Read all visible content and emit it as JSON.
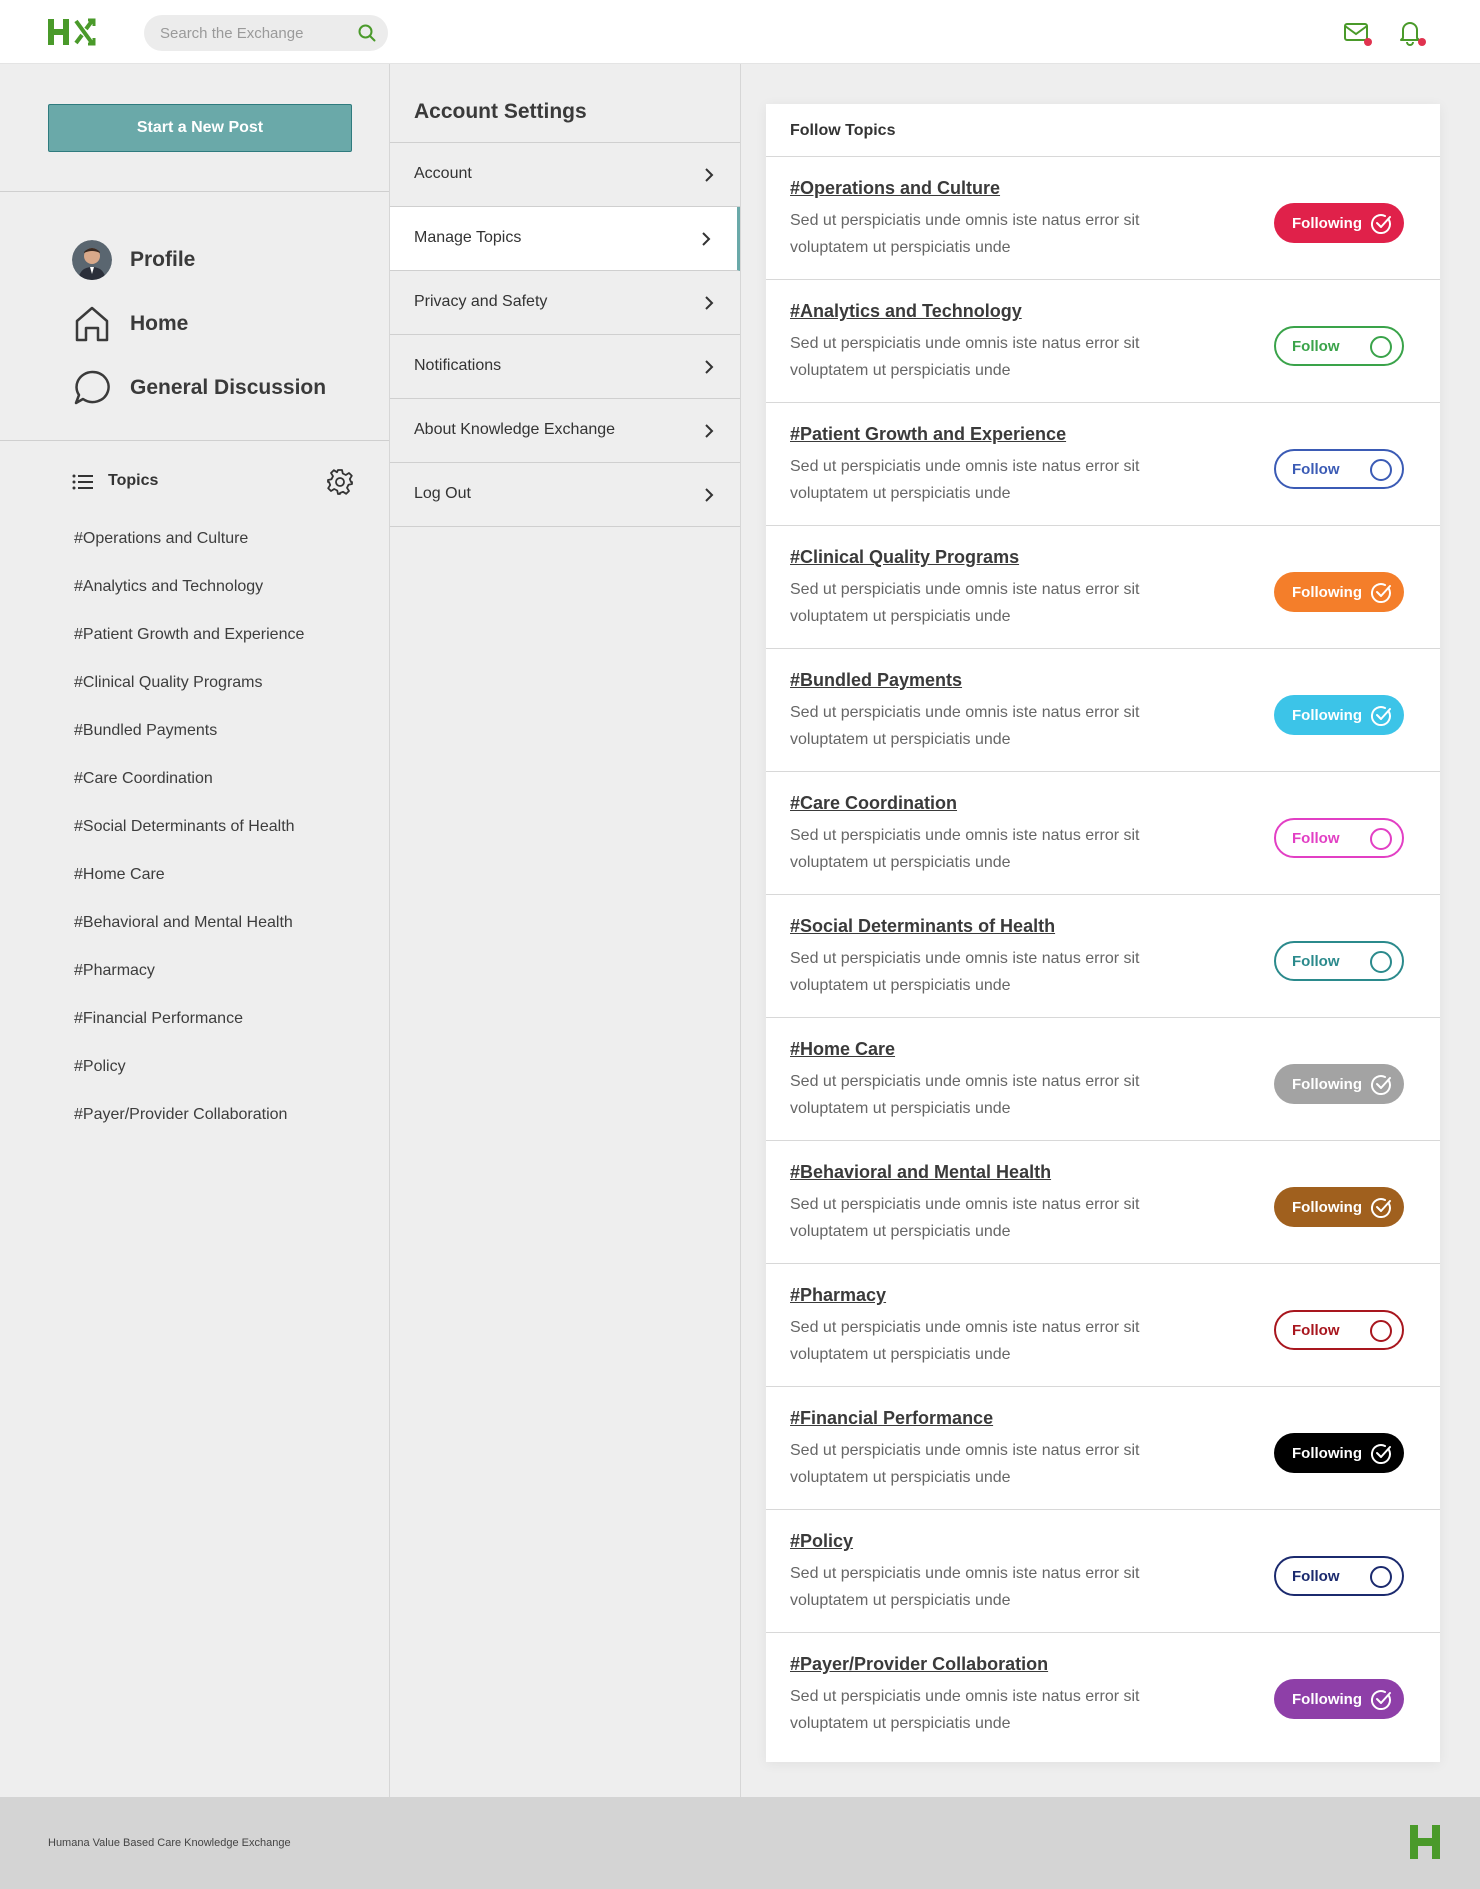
{
  "header": {
    "logo": "HX",
    "search_placeholder": "Search the Exchange",
    "icons": [
      "mail-icon",
      "bell-icon"
    ]
  },
  "sidebar": {
    "new_post_label": "Start a New Post",
    "nav": [
      {
        "label": "Profile",
        "icon": "avatar"
      },
      {
        "label": "Home",
        "icon": "home-icon"
      },
      {
        "label": "General Discussion",
        "icon": "chat-icon"
      }
    ],
    "topics_label": "Topics",
    "topics": [
      "#Operations and Culture",
      "#Analytics and Technology",
      "#Patient Growth and Experience",
      "#Clinical Quality Programs",
      "#Bundled Payments",
      "#Care Coordination",
      "#Social Determinants of Health",
      "#Home Care",
      "#Behavioral and Mental Health",
      "#Pharmacy",
      "#Financial Performance",
      "#Policy",
      "#Payer/Provider Collaboration"
    ]
  },
  "settings": {
    "title": "Account Settings",
    "menu": [
      {
        "label": "Account",
        "active": false
      },
      {
        "label": "Manage Topics",
        "active": true
      },
      {
        "label": "Privacy and Safety",
        "active": false
      },
      {
        "label": "Notifications",
        "active": false
      },
      {
        "label": "About Knowledge Exchange",
        "active": false
      },
      {
        "label": "Log Out",
        "active": false
      }
    ]
  },
  "follow_topics": {
    "title": "Follow Topics",
    "items": [
      {
        "title": "#Operations and Culture",
        "desc": "Sed ut perspiciatis unde omnis iste natus error sit voluptatem ut perspiciatis unde",
        "state": "Following",
        "color": "#e0214a"
      },
      {
        "title": "#Analytics and Technology",
        "desc": "Sed ut perspiciatis unde omnis iste natus error sit voluptatem ut perspiciatis unde",
        "state": "Follow",
        "color": "#3aa34a"
      },
      {
        "title": "#Patient Growth and Experience",
        "desc": "Sed ut perspiciatis unde omnis iste natus error sit voluptatem ut perspiciatis unde",
        "state": "Follow",
        "color": "#3b5bb5"
      },
      {
        "title": "#Clinical Quality Programs",
        "desc": "Sed ut perspiciatis unde omnis iste natus error sit voluptatem ut perspiciatis unde",
        "state": "Following",
        "color": "#f47e2a"
      },
      {
        "title": "#Bundled Payments",
        "desc": "Sed ut perspiciatis unde omnis iste natus error sit voluptatem ut perspiciatis unde",
        "state": "Following",
        "color": "#3cc4e8"
      },
      {
        "title": "#Care Coordination",
        "desc": "Sed ut perspiciatis unde omnis iste natus error sit voluptatem ut perspiciatis unde",
        "state": "Follow",
        "color": "#e23fc4"
      },
      {
        "title": "#Social Determinants of Health",
        "desc": "Sed ut perspiciatis unde omnis iste natus error sit voluptatem ut perspiciatis unde",
        "state": "Follow",
        "color": "#2b8a8c"
      },
      {
        "title": "#Home Care",
        "desc": "Sed ut perspiciatis unde omnis iste natus error sit voluptatem ut perspiciatis unde",
        "state": "Following",
        "color": "#a3a3a3"
      },
      {
        "title": "#Behavioral and Mental Health",
        "desc": "Sed ut perspiciatis unde omnis iste natus error sit voluptatem ut perspiciatis unde",
        "state": "Following",
        "color": "#a0601e"
      },
      {
        "title": "#Pharmacy",
        "desc": "Sed ut perspiciatis unde omnis iste natus error sit voluptatem ut perspiciatis unde",
        "state": "Follow",
        "color": "#a8161e"
      },
      {
        "title": "#Financial Performance",
        "desc": "Sed ut perspiciatis unde omnis iste natus error sit voluptatem ut perspiciatis unde",
        "state": "Following",
        "color": "#000000"
      },
      {
        "title": "#Policy",
        "desc": "Sed ut perspiciatis unde omnis iste natus error sit voluptatem ut perspiciatis unde",
        "state": "Follow",
        "color": "#1b2a6e"
      },
      {
        "title": "#Payer/Provider Collaboration",
        "desc": "Sed ut perspiciatis unde omnis iste natus error sit voluptatem ut perspiciatis unde",
        "state": "Following",
        "color": "#8e3fa8"
      }
    ]
  },
  "footer": {
    "text": "Humana Value Based Care Knowledge Exchange",
    "logo": "H"
  },
  "colors": {
    "brand_green": "#4a9a2a",
    "accent_teal": "#6aa9a9",
    "notification_dot": "#e0334f"
  }
}
